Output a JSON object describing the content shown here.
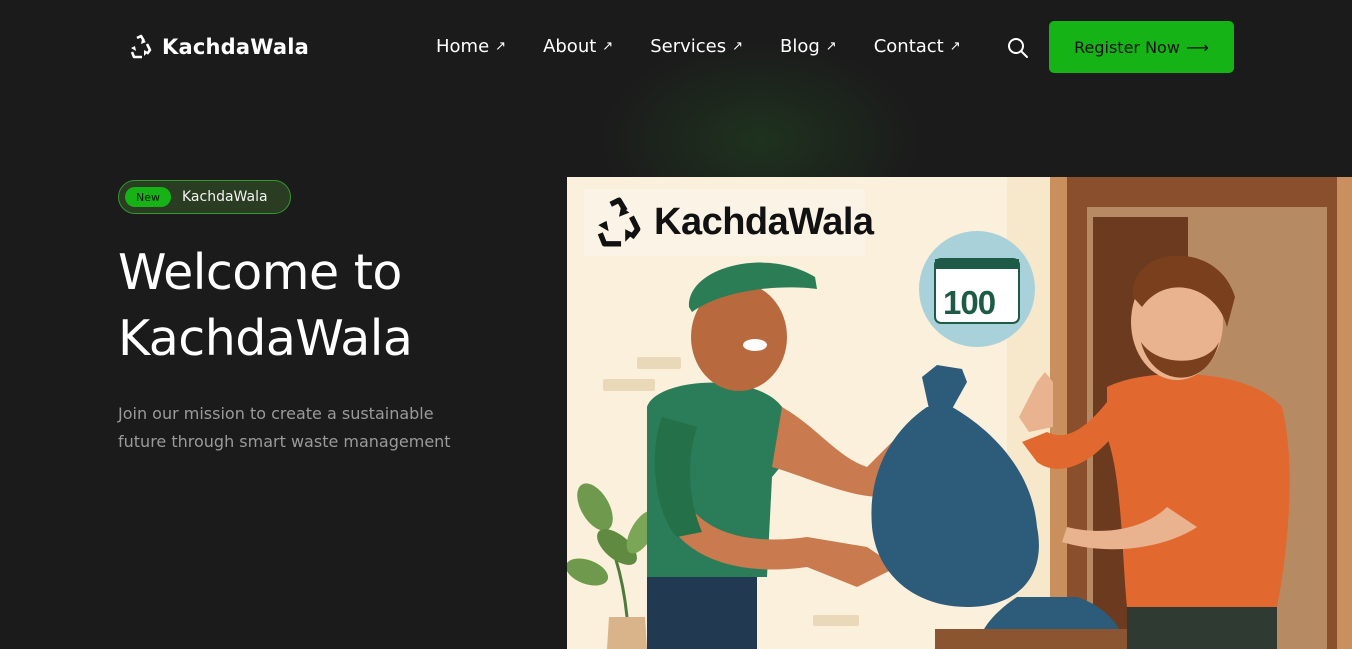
{
  "brand": {
    "name": "KachdaWala",
    "icon": "recycle-icon"
  },
  "nav": {
    "items": [
      {
        "label": "Home",
        "arrow": "↗"
      },
      {
        "label": "About",
        "arrow": "↗"
      },
      {
        "label": "Services",
        "arrow": "↗"
      },
      {
        "label": "Blog",
        "arrow": "↗"
      },
      {
        "label": "Contact",
        "arrow": "↗"
      }
    ],
    "search_icon": "search-icon"
  },
  "cta": {
    "label": "Register Now",
    "arrow": "⟶"
  },
  "hero": {
    "badge_pill": "New",
    "badge_label": "KachdaWala",
    "title": "Welcome to KachdaWala",
    "subtitle": "Join our mission to create a sustainable future through smart waste management"
  },
  "illustration": {
    "logo_text": "KachdaWala",
    "calendar_number": "100"
  },
  "colors": {
    "background": "#1b1b1b",
    "accent": "#16b316",
    "illustration_bg": "#fbf0dc"
  }
}
